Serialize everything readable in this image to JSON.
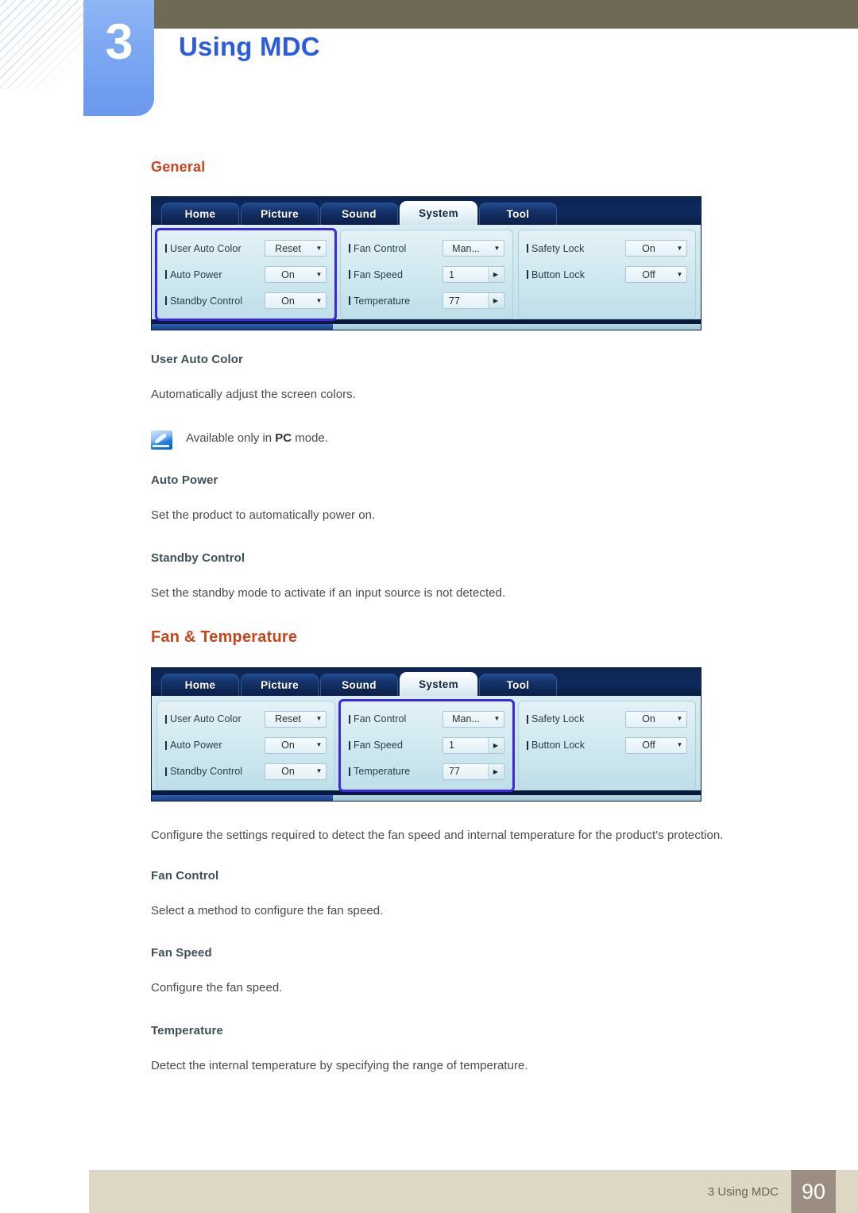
{
  "header": {
    "chapter_number": "3",
    "chapter_title": "Using MDC",
    "chapter_accent_color": "#2b5cdb",
    "bar_color": "#6e6a55"
  },
  "sections": [
    {
      "title": "General",
      "title_color": "#c8451c"
    },
    {
      "title": "Fan & Temperature",
      "title_color": "#c8451c"
    }
  ],
  "mdc_panel": {
    "tabs": [
      {
        "label": "Home",
        "active": false
      },
      {
        "label": "Picture",
        "active": false
      },
      {
        "label": "Sound",
        "active": false
      },
      {
        "label": "System",
        "active": true
      },
      {
        "label": "Tool",
        "active": false
      }
    ],
    "groups": {
      "general": [
        {
          "label": "User Auto Color",
          "value": "Reset",
          "control": "dropdown"
        },
        {
          "label": "Auto Power",
          "value": "On",
          "control": "dropdown"
        },
        {
          "label": "Standby Control",
          "value": "On",
          "control": "dropdown"
        }
      ],
      "fan_temperature": [
        {
          "label": "Fan Control",
          "value": "Man...",
          "control": "dropdown"
        },
        {
          "label": "Fan Speed",
          "value": "1",
          "control": "spinner"
        },
        {
          "label": "Temperature",
          "value": "77",
          "control": "spinner"
        }
      ],
      "locks": [
        {
          "label": "Safety Lock",
          "value": "On",
          "control": "dropdown"
        },
        {
          "label": "Button Lock",
          "value": "Off",
          "control": "dropdown"
        }
      ]
    },
    "selection_highlight_color": "#3c27e8"
  },
  "general_topics": [
    {
      "heading": "User Auto Color",
      "body": "Automatically adjust the screen colors."
    },
    {
      "heading": "Auto Power",
      "body": "Set the product to automatically power on."
    },
    {
      "heading": "Standby Control",
      "body": "Set the standby mode to activate if an input source is not detected."
    }
  ],
  "note": {
    "prefix": "Available only in ",
    "emphasis": "PC",
    "suffix": " mode.",
    "icon": "note-pencil-icon"
  },
  "fan_intro": "Configure the settings required to detect the fan speed and internal temperature for the product's protection.",
  "fan_topics": [
    {
      "heading": "Fan Control",
      "body": "Select a method to configure the fan speed."
    },
    {
      "heading": "Fan Speed",
      "body": "Configure the fan speed."
    },
    {
      "heading": "Temperature",
      "body": "Detect the internal temperature by specifying the range of temperature."
    }
  ],
  "footer": {
    "label": "3 Using MDC",
    "page_number": "90"
  }
}
